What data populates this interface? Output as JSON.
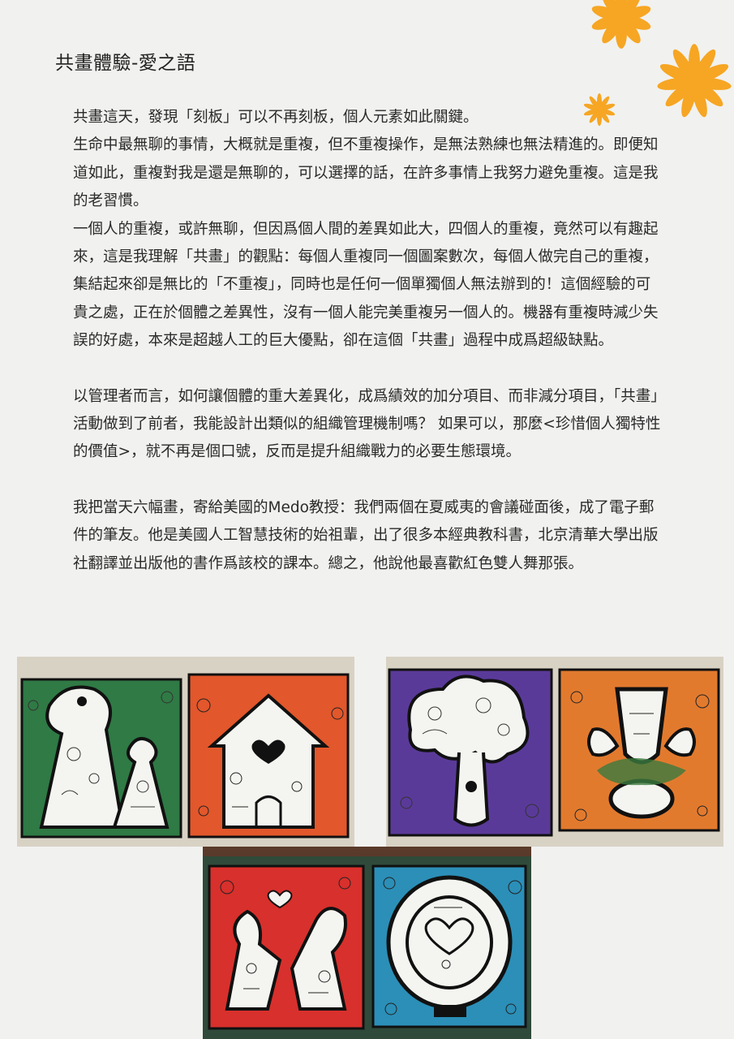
{
  "article": {
    "title": "共畫體驗-愛之語",
    "paragraphs": [
      "共畫這天，發現「刻板」可以不再刻板，個人元素如此關鍵。\n生命中最無聊的事情，大概就是重複，但不重複操作，是無法熟練也無法精進的。即便知道如此，重複對我是還是無聊的，可以選擇的話，在許多事情上我努力避免重複。這是我的老習慣。\n一個人的重複，或許無聊，但因爲個人間的差異如此大，四個人的重複，竟然可以有趣起來，這是我理解「共畫」的觀點：每個人重複同一個圖案數次，每個人做完自己的重複，集結起來卻是無比的「不重複」，同時也是任何一個單獨個人無法辦到的！這個經驗的可貴之處，正在於個體之差異性，沒有一個人能完美重複另一個人的。機器有重複時減少失誤的好處，本來是超越人工的巨大優點，卻在這個「共畫」過程中成爲超級缺點。",
      "以管理者而言，如何讓個體的重大差異化，成爲績效的加分項目、而非減分項目，「共畫」活動做到了前者，我能設計出類似的組織管理機制嗎？ 如果可以，那麼<珍惜個人獨特性的價值>，就不再是個口號，反而是提升組織戰力的必要生態環境。",
      "我把當天六幅畫，寄給美國的Medo教授：我們兩個在夏威夷的會議碰面後，成了電子郵件的筆友。他是美國人工智慧技術的始祖輩，出了很多本經典教科書，北京清華大學出版社翻譯並出版他的書作爲該校的課本。總之，他說他最喜歡紅色雙人舞那張。"
    ]
  },
  "colors": {
    "flower": "#f6a623",
    "green_bg": "#2f7a45",
    "orange_bg": "#e2572b",
    "purple_bg": "#5a3a99",
    "orange2_bg": "#e27a2e",
    "red_bg": "#d8302c",
    "blue_bg": "#2b8fb8",
    "wall": "#d8d2c4",
    "board": "#2f4a3a"
  },
  "photos": [
    {
      "name": "photo-green-orange",
      "panels": [
        "green_bg",
        "orange_bg"
      ],
      "motifs": [
        "keyhole-figures",
        "house-heart"
      ]
    },
    {
      "name": "photo-purple-orange",
      "panels": [
        "purple_bg",
        "orange2_bg"
      ],
      "motifs": [
        "tree-figure",
        "trophy-figure"
      ]
    },
    {
      "name": "photo-red-blue",
      "panels": [
        "red_bg",
        "blue_bg"
      ],
      "motifs": [
        "dancing-pair",
        "heart-hug"
      ]
    }
  ]
}
